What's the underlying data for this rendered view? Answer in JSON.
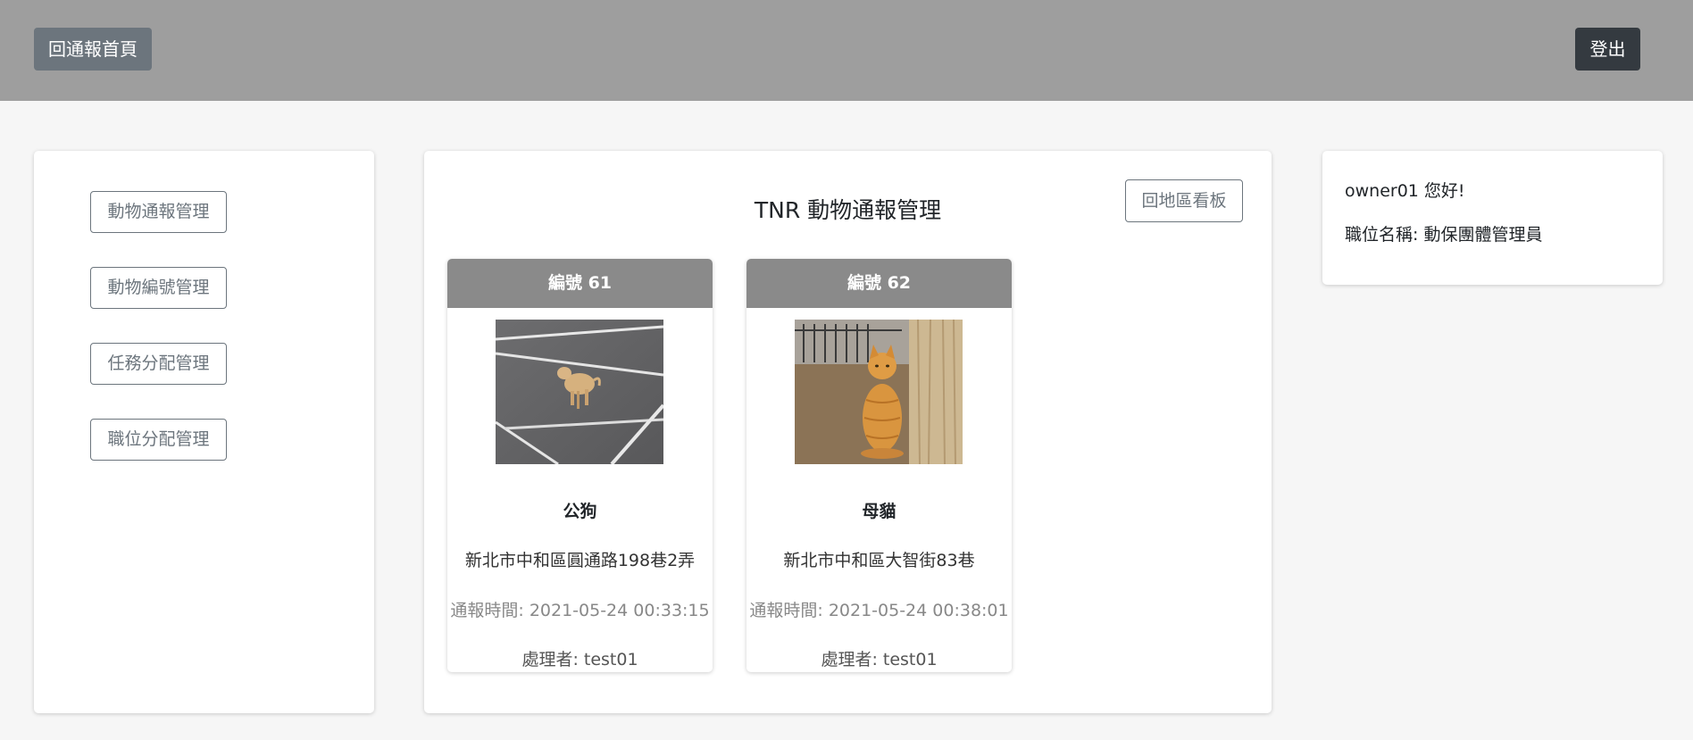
{
  "header": {
    "home_label": "回通報首頁",
    "logout_label": "登出"
  },
  "sidebar": {
    "items": [
      {
        "label": "動物通報管理"
      },
      {
        "label": "動物編號管理"
      },
      {
        "label": "任務分配管理"
      },
      {
        "label": "職位分配管理"
      }
    ]
  },
  "main": {
    "title": "TNR 動物通報管理",
    "region_button": "回地區看板",
    "cards": [
      {
        "header": "編號 61",
        "image": "dog-photo",
        "type": "公狗",
        "address": "新北市中和區圓通路198巷2弄",
        "time": "通報時間: 2021-05-24 00:33:15",
        "handler": "處理者: test01"
      },
      {
        "header": "編號 62",
        "image": "cat-photo",
        "type": "母貓",
        "address": "新北市中和區大智街83巷",
        "time": "通報時間: 2021-05-24 00:38:01",
        "handler": "處理者: test01"
      }
    ]
  },
  "user": {
    "greeting": "owner01 您好!",
    "role": "職位名稱: 動保團體管理員"
  },
  "colors": {
    "topbar": "#9e9e9e",
    "home_button": "#6c757d",
    "logout_button": "#343a40",
    "card_header": "#8a8a8a",
    "background": "#f6f6f6"
  }
}
